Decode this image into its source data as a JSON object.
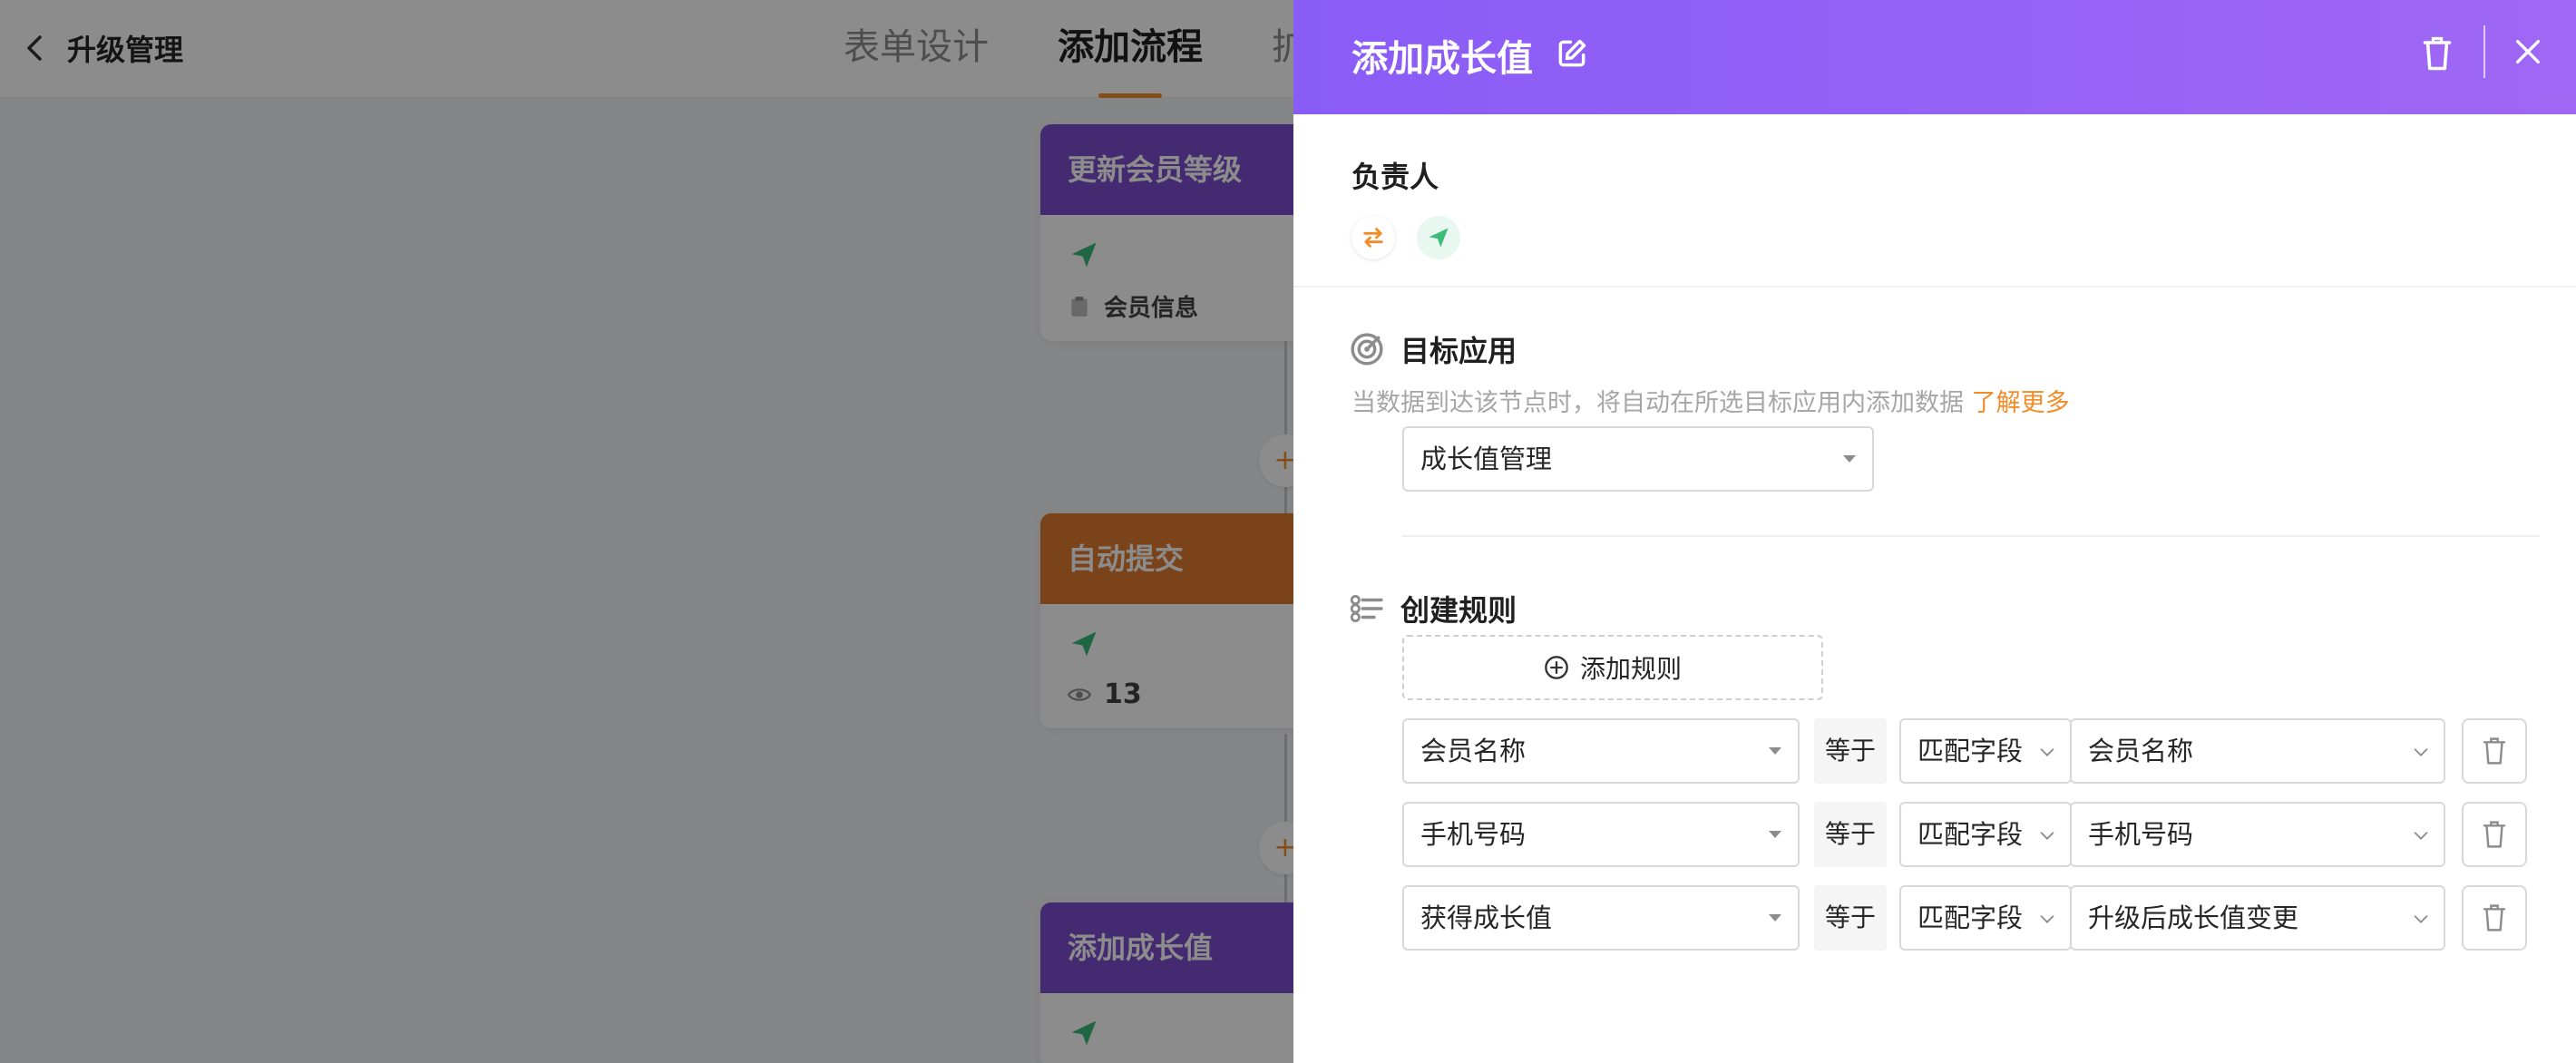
{
  "header": {
    "back_label": "升级管理",
    "tabs": [
      {
        "label": "表单设计"
      },
      {
        "label": "添加流程"
      },
      {
        "label": "扩"
      }
    ]
  },
  "flow": {
    "nodes": [
      {
        "title": "更新会员等级",
        "meta": "会员信息",
        "color": "#7c4dcc"
      },
      {
        "title": "自动提交",
        "meta": "13",
        "color": "#e07a2e"
      },
      {
        "title": "添加成长值",
        "color": "#7c4dcc"
      }
    ],
    "plus_symbol": "+"
  },
  "drawer": {
    "title": "添加成长值",
    "owner_label": "负责人",
    "target_app": {
      "title": "目标应用",
      "description": "当数据到达该节点时，将自动在所选目标应用内添加数据",
      "learn_more": "了解更多",
      "selected": "成长值管理"
    },
    "rules": {
      "title": "创建规则",
      "add_label": "添加规则",
      "items": [
        {
          "field": "会员名称",
          "operator": "等于",
          "mode": "匹配字段",
          "value": "会员名称"
        },
        {
          "field": "手机号码",
          "operator": "等于",
          "mode": "匹配字段",
          "value": "手机号码"
        },
        {
          "field": "获得成长值",
          "operator": "等于",
          "mode": "匹配字段",
          "value": "升级后成长值变更"
        }
      ]
    }
  },
  "colors": {
    "accent_orange": "#f28c28",
    "drawer_gradient_start": "#8a5cf6",
    "drawer_gradient_end": "#a067f5",
    "send_green": "#3dbb78"
  }
}
